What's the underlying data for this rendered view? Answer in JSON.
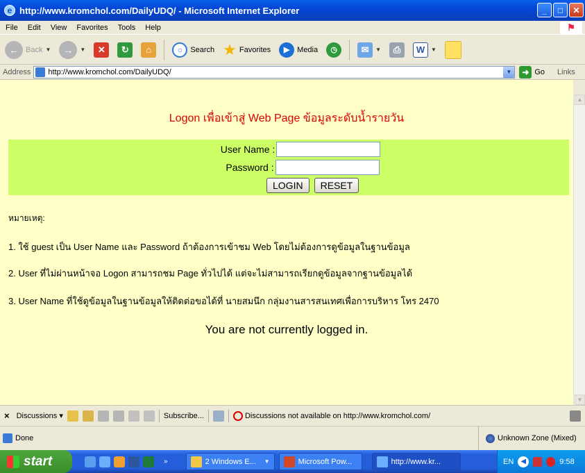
{
  "window": {
    "title": "http://www.kromchol.com/DailyUDQ/ - Microsoft Internet Explorer"
  },
  "menu": [
    "File",
    "Edit",
    "View",
    "Favorites",
    "Tools",
    "Help"
  ],
  "toolbar": {
    "back": "Back",
    "search": "Search",
    "favorites": "Favorites",
    "media": "Media"
  },
  "address": {
    "label": "Address",
    "url": "http://www.kromchol.com/DailyUDQ/",
    "go": "Go",
    "links": "Links"
  },
  "page": {
    "heading": "Logon เพื่อเข้าสู่ Web Page ข้อมูลระดับน้ำรายวัน",
    "username_label": "User Name :",
    "password_label": "Password :",
    "login_label": "LOGIN",
    "reset_label": "RESET",
    "notes_title": "หมายเหตุ:",
    "note1": "1. ใช้ guest เป็น User Name และ Password ถ้าต้องการเข้าชม Web โดยไม่ต้องการดูข้อมูลในฐานข้อมูล",
    "note2": "2. User ที่ไม่ผ่านหน้าจอ Logon สามารถชม Page ทั่วไปได้ แต่จะไม่สามารถเรียกดูข้อมูลจากฐานข้อมูลได้",
    "note3": "3. User Name ที่ใช้ดูข้อมูลในฐานข้อมูลให้ติดต่อขอได้ที่ นายสมนึก กลุ่มงานสารสนเทศเพื่อการบริหาร โทร 2470",
    "status_message": "You are not currently logged in."
  },
  "discussions": {
    "label": "Discussions",
    "subscribe": "Subscribe...",
    "unavailable": "Discussions not available on http://www.kromchol.com/"
  },
  "statusbar": {
    "status": "Done",
    "zone": "Unknown Zone (Mixed)"
  },
  "taskbar": {
    "start": "start",
    "tasks": [
      "2 Windows E...",
      "Microsoft Pow...",
      "http://www.kr..."
    ],
    "lang": "EN",
    "clock": "9:58"
  }
}
